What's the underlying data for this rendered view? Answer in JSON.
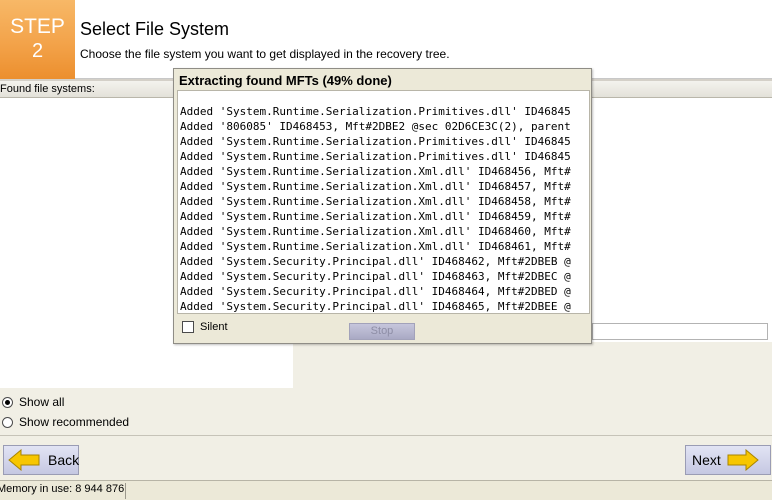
{
  "header": {
    "step_word": "STEP",
    "step_number": "2",
    "title": "Select File System",
    "subtitle": "Choose the file system you want to get displayed in the recovery tree."
  },
  "found_label": "Found file systems:",
  "dialog": {
    "title": "Extracting found MFTs (49% done)",
    "progress_percent": 49,
    "log_lines": [
      "Added 'System.Runtime.Serialization.Primitives.dll' ID46845",
      "Added '806085' ID468453, Mft#2DBE2 @sec 02D6CE3C(2), parent",
      "Added 'System.Runtime.Serialization.Primitives.dll' ID46845",
      "Added 'System.Runtime.Serialization.Primitives.dll' ID46845",
      "Added 'System.Runtime.Serialization.Xml.dll' ID468456, Mft#",
      "Added 'System.Runtime.Serialization.Xml.dll' ID468457, Mft#",
      "Added 'System.Runtime.Serialization.Xml.dll' ID468458, Mft#",
      "Added 'System.Runtime.Serialization.Xml.dll' ID468459, Mft#",
      "Added 'System.Runtime.Serialization.Xml.dll' ID468460, Mft#",
      "Added 'System.Runtime.Serialization.Xml.dll' ID468461, Mft#",
      "Added 'System.Security.Principal.dll' ID468462, Mft#2DBEB @",
      "Added 'System.Security.Principal.dll' ID468463, Mft#2DBEC @",
      "Added 'System.Security.Principal.dll' ID468464, Mft#2DBED @",
      "Added 'System.Security.Principal.dll' ID468465, Mft#2DBEE @"
    ],
    "silent_label": "Silent",
    "silent_checked": false,
    "stop_label": "Stop"
  },
  "options": {
    "show_all_label": "Show all",
    "show_all_selected": true,
    "show_recommended_label": "Show recommended",
    "show_recommended_selected": false
  },
  "buttons": {
    "back_label": "Back",
    "next_label": "Next",
    "arrow_color": "#f7c600"
  },
  "status": {
    "memory_text": "Memory in use: 8 944 876"
  },
  "colors": {
    "step_orange": "#f3a34a",
    "panel_beige": "#f1efe5"
  }
}
